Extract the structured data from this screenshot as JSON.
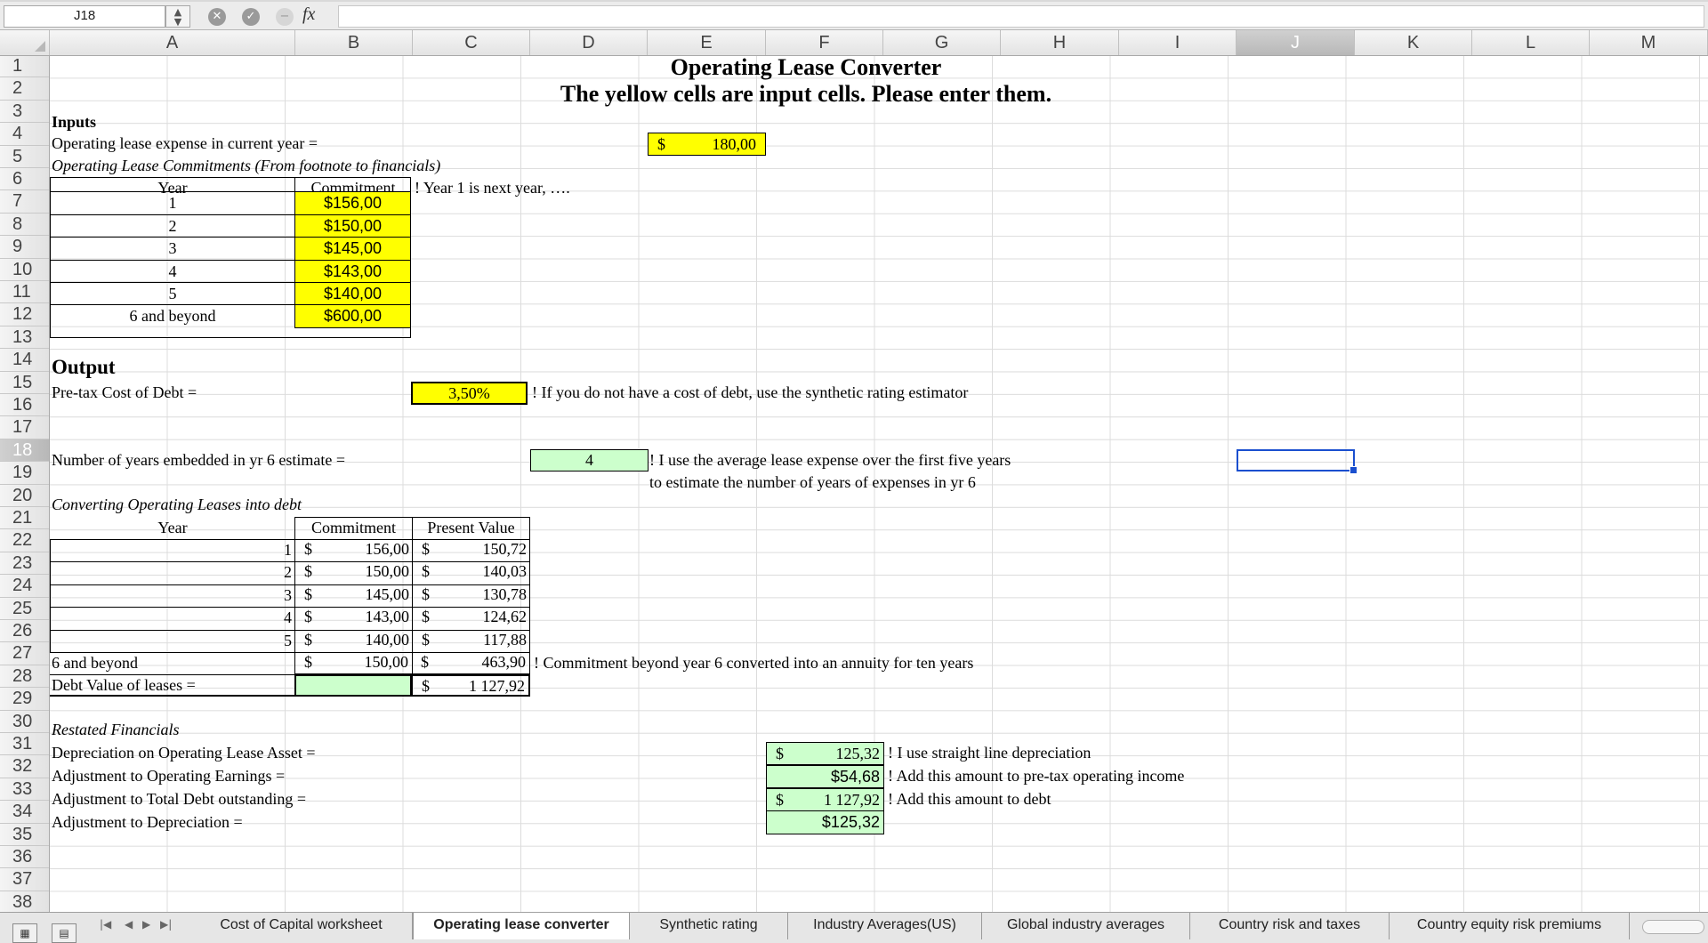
{
  "formula_bar": {
    "cell_ref": "J18",
    "fx": "fx",
    "cancel_icon": "close-icon",
    "accept_icon": "check-icon"
  },
  "columns": [
    "A",
    "B",
    "C",
    "D",
    "E",
    "F",
    "G",
    "H",
    "I",
    "J",
    "K",
    "L",
    "M"
  ],
  "selected_column": "J",
  "rows": [
    "1",
    "2",
    "3",
    "4",
    "5",
    "6",
    "7",
    "8",
    "9",
    "10",
    "11",
    "12",
    "13",
    "14",
    "15",
    "16",
    "17",
    "18",
    "19",
    "20",
    "21",
    "22",
    "23",
    "24",
    "25",
    "26",
    "27",
    "28",
    "29",
    "30",
    "31",
    "32",
    "33",
    "34",
    "35",
    "36",
    "37",
    "38"
  ],
  "selected_row": "18",
  "colors": {
    "input_yellow": "#ffff00",
    "output_green": "#ccffcc",
    "selection_blue": "#1a4fcf"
  },
  "sheet": {
    "title": "Operating Lease Converter",
    "subtitle": "The yellow cells are input cells. Please enter them.",
    "inputs_header": "Inputs",
    "lease_expense_label": "Operating lease expense in current year =",
    "lease_expense_currency": "$",
    "lease_expense_value": "180,00",
    "commitments_label": "Operating Lease Commitments (From footnote to financials)",
    "year_header": "Year",
    "commitment_header": "Commitment",
    "year_note": "! Year 1 is next year, ….",
    "commitments": [
      {
        "year": "1",
        "value": "$156,00"
      },
      {
        "year": "2",
        "value": "$150,00"
      },
      {
        "year": "3",
        "value": "$145,00"
      },
      {
        "year": "4",
        "value": "$143,00"
      },
      {
        "year": "5",
        "value": "$140,00"
      },
      {
        "year": "6 and beyond",
        "value": "$600,00"
      }
    ],
    "output_header": "Output",
    "cost_of_debt_label": "Pre-tax Cost of Debt =",
    "cost_of_debt_value": "3,50%",
    "cost_of_debt_note": "! If you do not have a cost of debt, use the synthetic rating estimator",
    "years_embedded_label": "Number of years embedded in yr 6 estimate =",
    "years_embedded_value": "4",
    "years_embedded_note1": "! I use the average lease expense over the first five years",
    "years_embedded_note2": "to estimate the number of years of expenses in yr 6",
    "converting_label": "Converting Operating Leases into debt",
    "pv_header": "Present Value",
    "pv_rows": [
      {
        "year": "1",
        "commitment": "156,00",
        "pv": "150,72"
      },
      {
        "year": "2",
        "commitment": "150,00",
        "pv": "140,03"
      },
      {
        "year": "3",
        "commitment": "145,00",
        "pv": "130,78"
      },
      {
        "year": "4",
        "commitment": "143,00",
        "pv": "124,62"
      },
      {
        "year": "5",
        "commitment": "140,00",
        "pv": "117,88"
      }
    ],
    "beyond_label": "6 and beyond",
    "beyond_commitment": "150,00",
    "beyond_pv": "463,90",
    "beyond_note": "! Commitment beyond year 6 converted into an annuity for ten years",
    "debt_value_label": "Debt Value of leases =",
    "debt_value": "1 127,92",
    "currency": "$",
    "restated_label": "Restated Financials",
    "restated": [
      {
        "label": "Depreciation on Operating Lease Asset =",
        "currency": "$",
        "value": "125,32",
        "note": "! I use straight line depreciation"
      },
      {
        "label": "Adjustment to Operating Earnings =",
        "currency": "",
        "value": "$54,68",
        "note": "! Add this amount to pre-tax operating income"
      },
      {
        "label": "Adjustment to Total Debt outstanding =",
        "currency": "$",
        "value": "1 127,92",
        "note": "! Add this amount to debt"
      },
      {
        "label": "Adjustment to Depreciation =",
        "currency": "",
        "value": "$125,32",
        "note": ""
      }
    ]
  },
  "tabs": [
    {
      "label": "Cost of Capital worksheet",
      "active": false
    },
    {
      "label": "Operating lease converter",
      "active": true
    },
    {
      "label": "Synthetic rating",
      "active": false
    },
    {
      "label": "Industry Averages(US)",
      "active": false
    },
    {
      "label": "Global industry averages",
      "active": false
    },
    {
      "label": "Country risk and taxes",
      "active": false
    },
    {
      "label": "Country equity risk premiums",
      "active": false
    }
  ],
  "tab_nav": {
    "first": "|◀",
    "prev": "◀",
    "next": "▶",
    "last": "▶|"
  },
  "view_buttons": {
    "normal": "▦",
    "page_layout": "▤"
  }
}
